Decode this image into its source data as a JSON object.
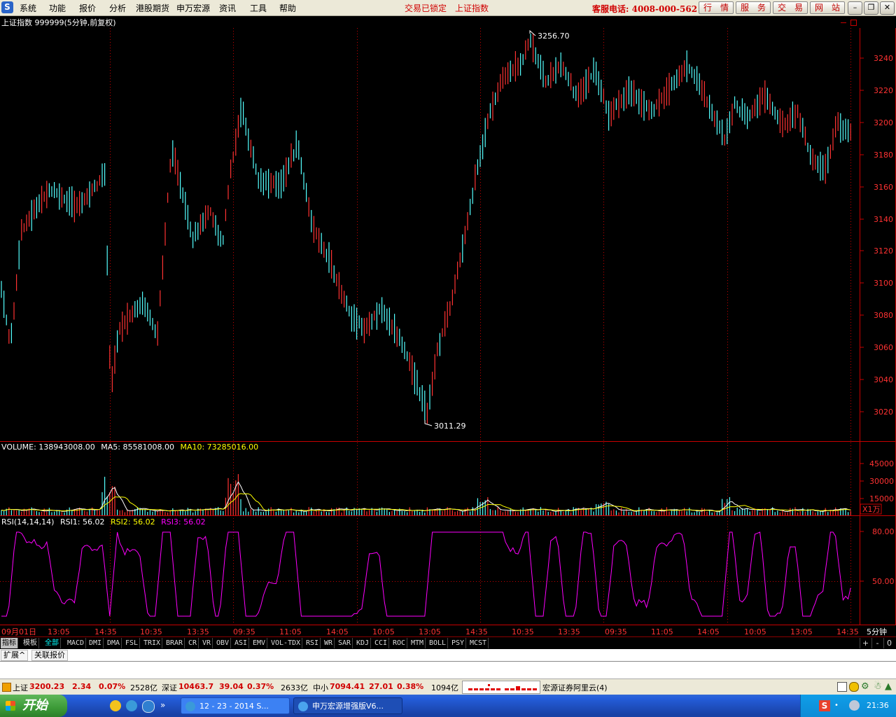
{
  "menu": {
    "items": [
      "系统",
      "功能",
      "报价",
      "分析",
      "港股期货",
      "申万宏源",
      "资讯",
      "工具",
      "帮助"
    ],
    "lock_status": "交易已锁定",
    "current_index": "上证指数",
    "hotline": "客服电话: 4008-000-562",
    "buttons": [
      "行　情",
      "服　务",
      "交　易",
      "网　站"
    ]
  },
  "chart": {
    "title": "上证指数 999999(5分钟,前复权)",
    "high_label": "3256.70",
    "low_label": "3011.29",
    "price_ticks": [
      "3240",
      "3220",
      "3200",
      "3180",
      "3160",
      "3140",
      "3120",
      "3100",
      "3080",
      "3060",
      "3040",
      "3020"
    ],
    "volume_header": {
      "label": "VOLUME: 138943008.00",
      "ma5": "MA5: 85581008.00",
      "ma10": "MA10: 73285016.00"
    },
    "volume_ticks": [
      "45000",
      "30000",
      "15000"
    ],
    "volume_unit": "X1万",
    "rsi_header": {
      "label": "RSI(14,14,14)",
      "rsi1": "RSI1: 56.02",
      "rsi2": "RSI2: 56.02",
      "rsi3": "RSI3: 56.02"
    },
    "rsi_ticks": [
      "80.00",
      "50.00"
    ],
    "time_labels": [
      "09月01日",
      "13:05",
      "14:35",
      "10:35",
      "13:35",
      "09:35",
      "11:05",
      "14:05",
      "10:05",
      "13:05",
      "14:35",
      "10:35",
      "13:35",
      "09:35",
      "11:05",
      "14:05",
      "10:05",
      "13:05",
      "14:35"
    ],
    "period": "5分钟",
    "colors": {
      "up": "#ff3232",
      "down": "#54ffff",
      "frame": "#c80000",
      "volume_ma5": "#ffffff",
      "volume_ma10": "#ffff00",
      "rsi": "#ff00ff"
    }
  },
  "tabs": {
    "items": [
      "指标",
      "模板",
      "全部",
      "MACD",
      "DMI",
      "DMA",
      "FSL",
      "TRIX",
      "BRAR",
      "CR",
      "VR",
      "OBV",
      "ASI",
      "EMV",
      "VOL-TDX",
      "RSI",
      "WR",
      "SAR",
      "KDJ",
      "CCI",
      "ROC",
      "MTM",
      "BOLL",
      "PSY",
      "MCST"
    ],
    "controls": [
      "+",
      "-",
      "0"
    ]
  },
  "subbar": {
    "expand": "扩展^",
    "linked_quote": "关联报价"
  },
  "status": {
    "sh": {
      "name": "上证",
      "value": "3200.23",
      "change": "2.34",
      "pct": "0.07%",
      "amount": "2528亿"
    },
    "sz": {
      "name": "深证",
      "value": "10463.7",
      "change": "39.04",
      "pct": "0.37%",
      "amount": "2633亿"
    },
    "zx": {
      "name": "中小",
      "value": "7094.41",
      "change": "27.01",
      "pct": "0.38%",
      "amount": "1094亿"
    },
    "broker": "宏源证券阿里云(4)"
  },
  "taskbar": {
    "start": "开始",
    "tasks": [
      "12 - 23 - 2014 S...",
      "申万宏源增强版V6..."
    ],
    "clock": "21:36"
  }
}
